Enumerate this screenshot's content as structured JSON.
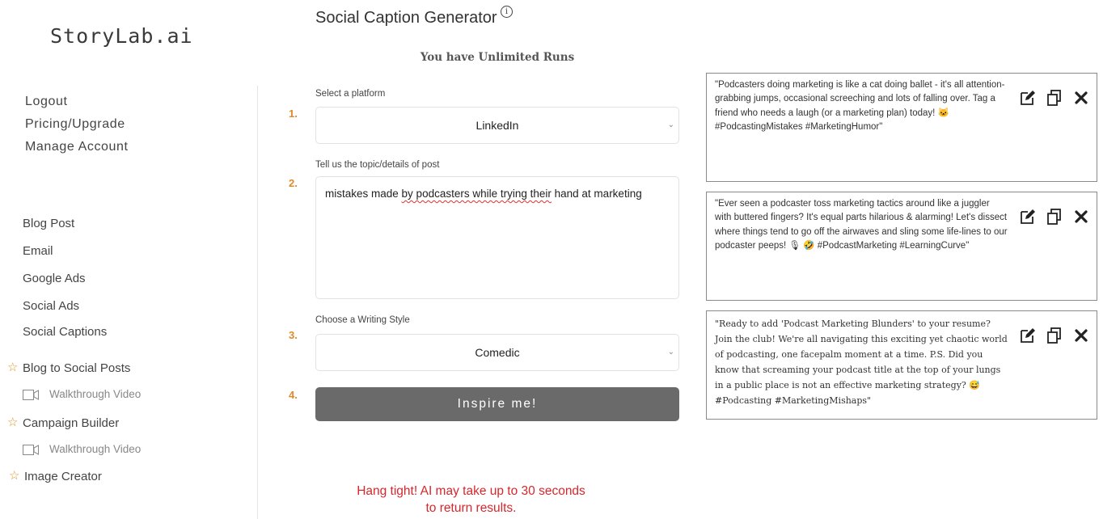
{
  "sidebar": {
    "brand": "StoryLab.ai",
    "account_links": [
      "Logout",
      "Pricing/Upgrade",
      "Manage Account"
    ],
    "tools": [
      "Blog Post",
      "Email",
      "Google Ads",
      "Social Ads",
      "Social Captions"
    ],
    "featured": [
      {
        "label": "Blog to Social Posts",
        "video": "Walkthrough Video"
      },
      {
        "label": "Campaign Builder",
        "video": "Walkthrough Video"
      },
      {
        "label": "Image Creator"
      }
    ]
  },
  "header": {
    "title": "Social Caption Generator",
    "runs": "You have Unlimited Runs"
  },
  "form": {
    "steps": [
      "1.",
      "2.",
      "3.",
      "4."
    ],
    "platform_label": "Select a platform",
    "platform_value": "LinkedIn",
    "topic_label": "Tell us the topic/details of post",
    "topic_prefix": "mistakes made ",
    "topic_misspelled": "by podcasters while trying their",
    "topic_suffix": " hand at marketing",
    "style_label": "Choose a Writing Style",
    "style_value": "Comedic",
    "submit_label": "Inspire me!",
    "wait_message_line1": "Hang tight! AI may take up to 30 seconds",
    "wait_message_line2": "to return results."
  },
  "results": [
    {
      "text": "\"Podcasters doing marketing is like a cat doing ballet - it's all attention-grabbing jumps, occasional screeching and lots of falling over. Tag a friend who needs a laugh (or a marketing plan) today! 🐱 #PodcastingMistakes #MarketingHumor\""
    },
    {
      "text": "\"Ever seen a podcaster toss marketing tactics around like a juggler with buttered fingers? It's equal parts hilarious & alarming! Let's dissect where things tend to go off the airwaves and sling some life-lines to our podcaster peeps! 🎙 🤣 #PodcastMarketing #LearningCurve\""
    },
    {
      "text": "\"Ready to add 'Podcast Marketing Blunders' to your resume? Join the club! We're all navigating this exciting yet chaotic world of podcasting, one facepalm moment at a time. P.S. Did you know that screaming your podcast title at the top of your lungs in a public place is not an effective marketing strategy? 😅 #Podcasting #MarketingMishaps\""
    }
  ],
  "colors": {
    "accent_step": "#e08a2a",
    "button_bg": "#6b6a6a",
    "warning": "#d7262c",
    "star": "#e0962a"
  }
}
